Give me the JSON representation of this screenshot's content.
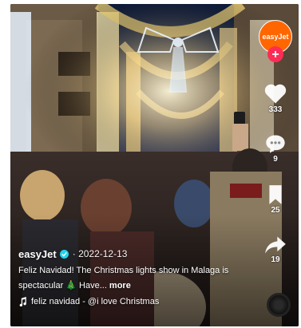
{
  "post": {
    "username": "easyJet",
    "date": "2022-12-13",
    "description": "Feliz Navidad! The Christmas lights show in Malaga is spectacular 🎄 Have...",
    "more_label": "more",
    "sound": "feliz navidad - @i love Christmas"
  },
  "profile": {
    "avatar_text": "easyJet",
    "follow_label": "+"
  },
  "actions": {
    "likes": "333",
    "comments": "9",
    "bookmarks": "25",
    "shares": "19"
  },
  "colors": {
    "brand": "#ff6600",
    "follow": "#fe2c55",
    "verified": "#20d5ec",
    "text": "#ffffff"
  }
}
